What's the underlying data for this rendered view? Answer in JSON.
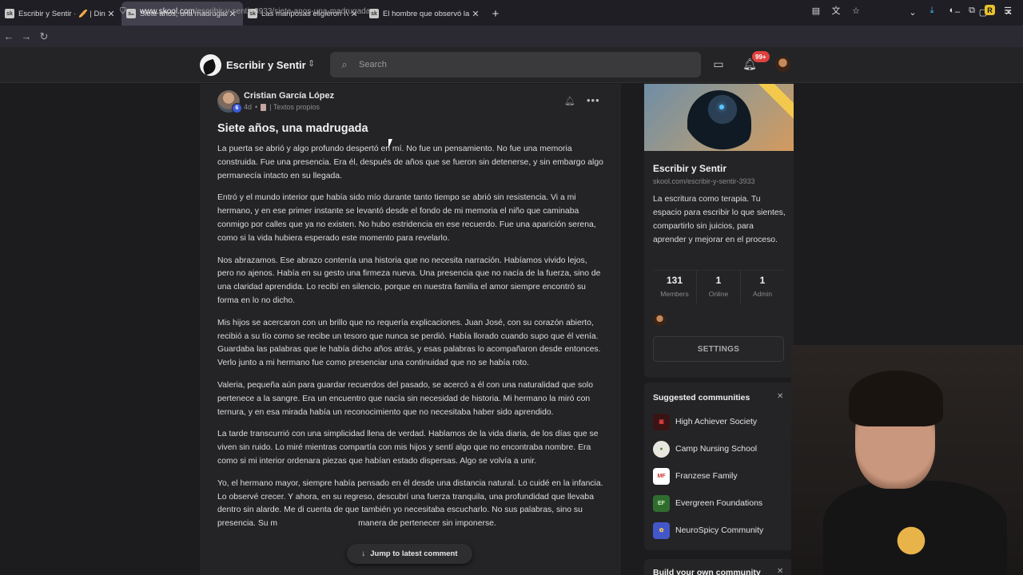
{
  "browser": {
    "tabs": [
      {
        "favicon": "sk",
        "label": "Escribir y Sentir · 🥖 | Dinámica"
      },
      {
        "favicon": "sk",
        "label": "Siete años, una madrugada · Es"
      },
      {
        "favicon": "sk",
        "label": "Las mariposas eligieron IV · Esc"
      },
      {
        "favicon": "sk",
        "label": "El hombre que observó la luz I ·"
      }
    ],
    "url_host": "www.skool.com",
    "url_path": "/escribir-y-sentir-3933/siete-anos-una-madrugada"
  },
  "header": {
    "community_name": "Escribir y Sentir",
    "search_placeholder": "Search",
    "notification_count": "99+"
  },
  "post": {
    "author": "Cristian García López",
    "level": "6",
    "age": "4d",
    "category": "| Textos propios",
    "title": "Siete años, una madrugada",
    "paragraphs": [
      "La puerta se abrió y algo profundo despertó en mí. No fue un pensamiento. No fue una memoria construida. Fue una presencia. Era él, después de años que se fueron sin detenerse, y sin embargo algo permanecía intacto en su llegada.",
      "Entró y el mundo interior que había sido mío durante tanto tiempo se abrió sin resistencia. Vi a mi hermano, y en ese primer instante se levantó desde el fondo de mi memoria el niño que caminaba conmigo por calles que ya no existen. No hubo estridencia en ese recuerdo. Fue una aparición serena, como si la vida hubiera esperado este momento para revelarlo.",
      "Nos abrazamos. Ese abrazo contenía una historia que no necesita narración. Habíamos vivido lejos, pero no ajenos. Había en su gesto una firmeza nueva. Una presencia que no nacía de la fuerza, sino de una claridad aprendida. Lo recibí en silencio, porque en nuestra familia el amor siempre encontró su forma en lo no dicho.",
      "Mis hijos se acercaron con un brillo que no requería explicaciones. Juan José, con su corazón abierto, recibió a su tío como se recibe un tesoro que nunca se perdió. Había llorado cuando supo que él venía. Guardaba las palabras que le había dicho años atrás, y esas palabras lo acompañaron desde entonces. Verlo junto a mi hermano fue como presenciar una continuidad que no se había roto.",
      "Valeria, pequeña aún para guardar recuerdos del pasado, se acercó a él con una naturalidad que solo pertenece a la sangre. Era un encuentro que nacía sin necesidad de historia. Mi hermano la miró con ternura, y en esa mirada había un reconocimiento que no necesitaba haber sido aprendido.",
      "La tarde transcurrió con una simplicidad llena de verdad. Hablamos de la vida diaria, de los días que se viven sin ruido. Lo miré mientras compartía con mis hijos y sentí algo que no encontraba nombre. Era como si mi interior ordenara piezas que habían estado dispersas. Algo se volvía a unir.",
      "Yo, el hermano mayor, siempre había pensado en él desde una distancia natural. Lo cuidé en la infancia. Lo observé crecer. Y ahora, en su regreso, descubrí una fuerza tranquila, una profundidad que llevaba dentro sin alarde. Me di cuenta de que también yo necesitaba escucharlo. No sus palabras, sino su presencia. Su m                                   manera de pertenecer sin imponerse."
    ],
    "jump_label": "Jump to latest comment"
  },
  "sidebar": {
    "name": "Escribir y Sentir",
    "url": "skool.com/escribir-y-sentir-3933",
    "description": "La escritura como terapia. Tu espacio para escribir lo que sientes, compartirlo sin juicios, para aprender y mejorar en el proceso.",
    "stats": [
      {
        "num": "131",
        "label": "Members"
      },
      {
        "num": "1",
        "label": "Online"
      },
      {
        "num": "1",
        "label": "Admin"
      }
    ],
    "settings_label": "SETTINGS"
  },
  "suggested": {
    "title": "Suggested communities",
    "items": [
      {
        "name": "High Achiever Society",
        "icon_bg": "#3a1414",
        "icon_color": "#e04040",
        "glyph": "▣"
      },
      {
        "name": "Camp Nursing School",
        "icon_bg": "#e9e6df",
        "icon_color": "#5a8a3a",
        "glyph": "●"
      },
      {
        "name": "Franzese Family",
        "icon_bg": "#ffffff",
        "icon_color": "#c33",
        "glyph": "MF"
      },
      {
        "name": "Evergreen Foundations",
        "icon_bg": "#2f6d2f",
        "icon_color": "#d8f0c0",
        "glyph": "EF"
      },
      {
        "name": "NeuroSpicy Community",
        "icon_bg": "#4357c9",
        "icon_color": "#ffd34d",
        "glyph": "✿"
      }
    ]
  },
  "build": {
    "title": "Build your own community"
  }
}
